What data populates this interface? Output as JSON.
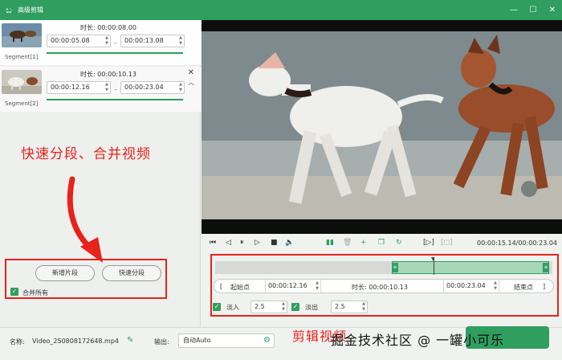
{
  "window": {
    "title": "高级剪辑"
  },
  "segments": [
    {
      "label": "Segment[1]",
      "duration_label": "时长:",
      "duration": "00:00:08.00",
      "start": "00:00:05.08",
      "end": "00:00:13.08"
    },
    {
      "label": "Segment[2]",
      "duration_label": "时长:",
      "duration": "00:00:10.13",
      "start": "00:00:12.16",
      "end": "00:00:23.04"
    }
  ],
  "left_panel": {
    "callout": "快速分段、合并视频",
    "add_segment": "新增片段",
    "quick_split": "快速分段",
    "merge_all": "合并所有"
  },
  "player": {
    "time_readout": "00:00:15.14/00:00:23.04"
  },
  "range": {
    "start_label": "起始点",
    "start_value": "00:00:12.16",
    "duration_label": "时长:",
    "duration_value": "00:00:10.13",
    "end_value": "00:00:23.04",
    "end_label": "结束点"
  },
  "fade": {
    "in_label": "淡入",
    "in_value": "2.5",
    "out_label": "淡出",
    "out_value": "2.5"
  },
  "bottom": {
    "name_label": "名称:",
    "file_name": "Video_250808172648.mp4",
    "output_label": "输出:",
    "output_value": "自动Auto",
    "callout": "剪辑视频",
    "watermark": "掘金技术社区 @ 一罐小可乐"
  },
  "colors": {
    "accent": "#2f9e5f",
    "callout": "#e8231a"
  }
}
